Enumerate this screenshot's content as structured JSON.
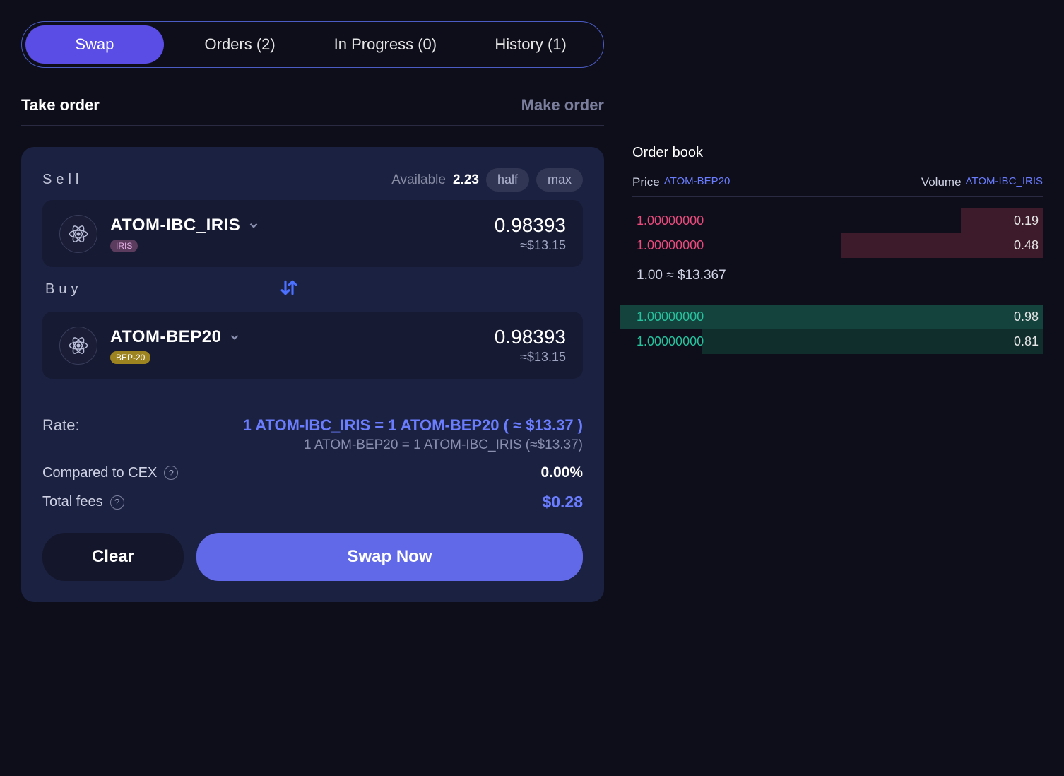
{
  "tabs": [
    {
      "label": "Swap",
      "active": true
    },
    {
      "label": "Orders (2)",
      "active": false
    },
    {
      "label": "In Progress (0)",
      "active": false
    },
    {
      "label": "History (1)",
      "active": false
    }
  ],
  "order_mode": {
    "take": "Take order",
    "make": "Make order"
  },
  "sell": {
    "label": "Sell",
    "available_label": "Available",
    "available_value": "2.23",
    "half": "half",
    "max": "max",
    "token": "ATOM-IBC_IRIS",
    "chain_badge": "IRIS",
    "amount": "0.98393",
    "amount_usd": "≈$13.15"
  },
  "buy": {
    "label": "Buy",
    "token": "ATOM-BEP20",
    "chain_badge": "BEP-20",
    "amount": "0.98393",
    "amount_usd": "≈$13.15"
  },
  "rate": {
    "label": "Rate:",
    "main": "1 ATOM-IBC_IRIS = 1 ATOM-BEP20 ( ≈ $13.37 )",
    "sub": "1 ATOM-BEP20 = 1 ATOM-IBC_IRIS (≈$13.37)"
  },
  "cex": {
    "label": "Compared to CEX",
    "value": "0.00%"
  },
  "fees": {
    "label": "Total fees",
    "value": "$0.28"
  },
  "actions": {
    "clear": "Clear",
    "swap": "Swap Now"
  },
  "orderbook": {
    "title": "Order book",
    "price_label": "Price",
    "price_symbol": "ATOM-BEP20",
    "volume_label": "Volume",
    "volume_symbol": "ATOM-IBC_IRIS",
    "sells": [
      {
        "price": "1.00000000",
        "vol": "0.19",
        "depth": 20
      },
      {
        "price": "1.00000000",
        "vol": "0.48",
        "depth": 49
      }
    ],
    "mid": "1.00 ≈ $13.367",
    "buys": [
      {
        "price": "1.00000000",
        "vol": "0.98",
        "depth": 100,
        "selected": true
      },
      {
        "price": "1.00000000",
        "vol": "0.81",
        "depth": 83,
        "selected": false
      }
    ]
  }
}
